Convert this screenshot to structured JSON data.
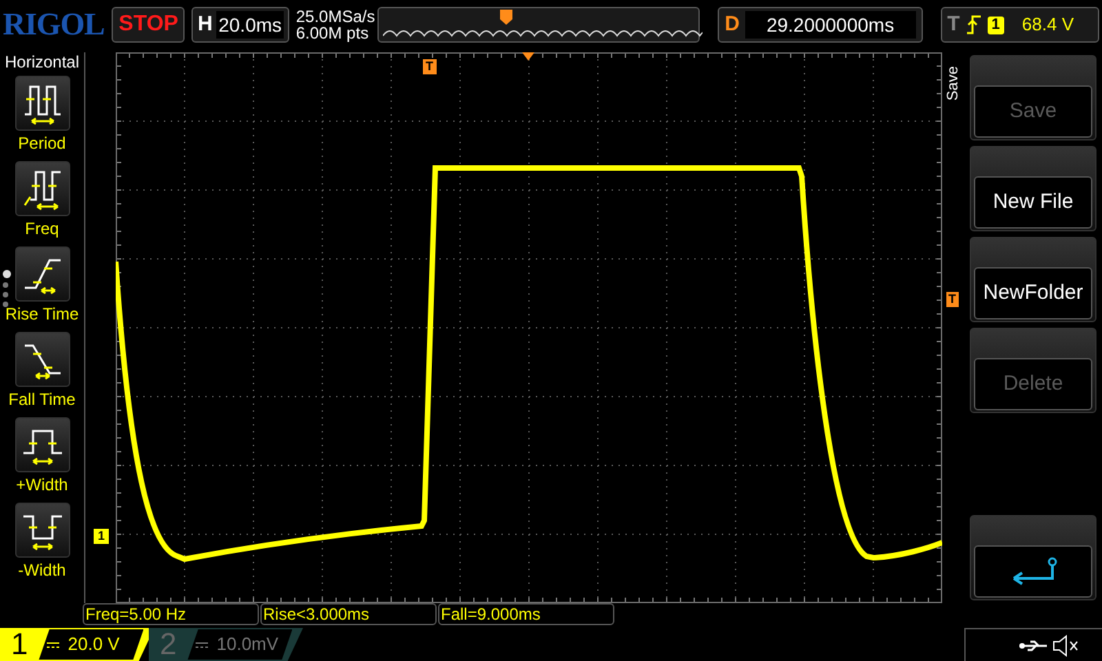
{
  "top_bar": {
    "logo": "RIGOL",
    "run_status": "STOP",
    "horizontal": {
      "label": "H",
      "timebase": "20.0ms"
    },
    "acquisition": {
      "sample_rate": "25.0MSa/s",
      "memory_depth": "6.00M pts"
    },
    "delay": {
      "label": "D",
      "value": "29.2000000ms"
    },
    "trigger": {
      "label": "T",
      "source": "1",
      "level": "68.4 V"
    }
  },
  "left_menu": {
    "title": "Horizontal",
    "items": [
      {
        "label": "Period",
        "kind": "period"
      },
      {
        "label": "Freq",
        "kind": "freq"
      },
      {
        "label": "Rise Time",
        "kind": "rise"
      },
      {
        "label": "Fall Time",
        "kind": "fall"
      },
      {
        "label": "+Width",
        "kind": "pwidth"
      },
      {
        "label": "-Width",
        "kind": "nwidth"
      }
    ],
    "pages": [
      {
        "selected": true
      },
      {
        "selected": false
      },
      {
        "selected": false
      },
      {
        "selected": false
      }
    ]
  },
  "waveform": {
    "trigger_position_marker": "T",
    "trigger_level_marker": "T",
    "channel_marker": "1"
  },
  "softkey_menu": {
    "title": "Save",
    "keys": [
      {
        "kind": "text",
        "label": "Save",
        "disabled": true
      },
      {
        "kind": "text",
        "label": "New File",
        "disabled": false
      },
      {
        "kind": "text",
        "label": "NewFolder",
        "disabled": false
      },
      {
        "kind": "text",
        "label": "Delete",
        "disabled": true
      },
      {
        "kind": "empty"
      },
      {
        "kind": "back"
      }
    ]
  },
  "measurements": [
    "Freq=5.00 Hz",
    "Rise<3.000ms",
    "Fall=9.000ms"
  ],
  "channels": [
    {
      "number": "1",
      "scale": "20.0 V",
      "selected": true
    },
    {
      "number": "2",
      "scale": "10.0mV",
      "selected": false
    }
  ]
}
